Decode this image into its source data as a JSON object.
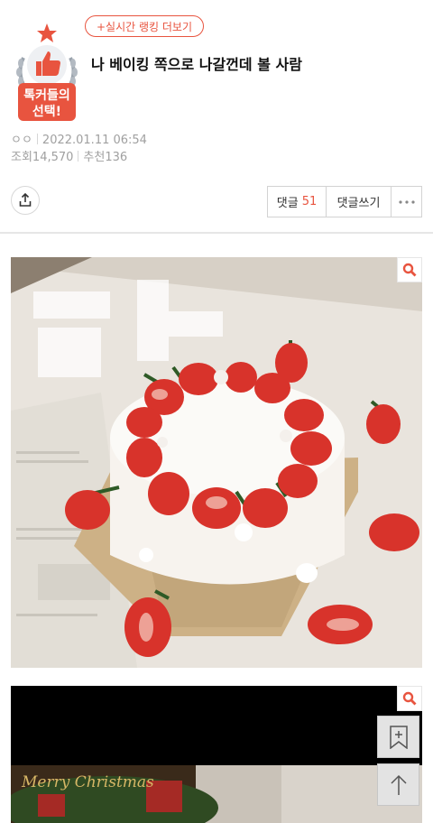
{
  "badge": {
    "line1": "톡커들의",
    "line2": "선택!"
  },
  "header": {
    "ranking_link": "+실시간 랭킹 더보기",
    "title": "나 베이킹 쪽으로 나갈껀데 볼 사람"
  },
  "meta": {
    "author": "ㅇㅇ",
    "date": "2022.01.11 06:54",
    "views_label": "조회",
    "views": "14,570",
    "recommend_label": "추천",
    "recommend": "136"
  },
  "actions": {
    "comments_label": "댓글",
    "comments_count": "51",
    "write_label": "댓글쓰기",
    "more_icon": "more-horizontal-icon"
  },
  "photo2": {
    "text": "Merry Christmas"
  },
  "colors": {
    "accent": "#e8543f",
    "divider": "#e6e6e6",
    "meta": "#a0a0a0"
  }
}
